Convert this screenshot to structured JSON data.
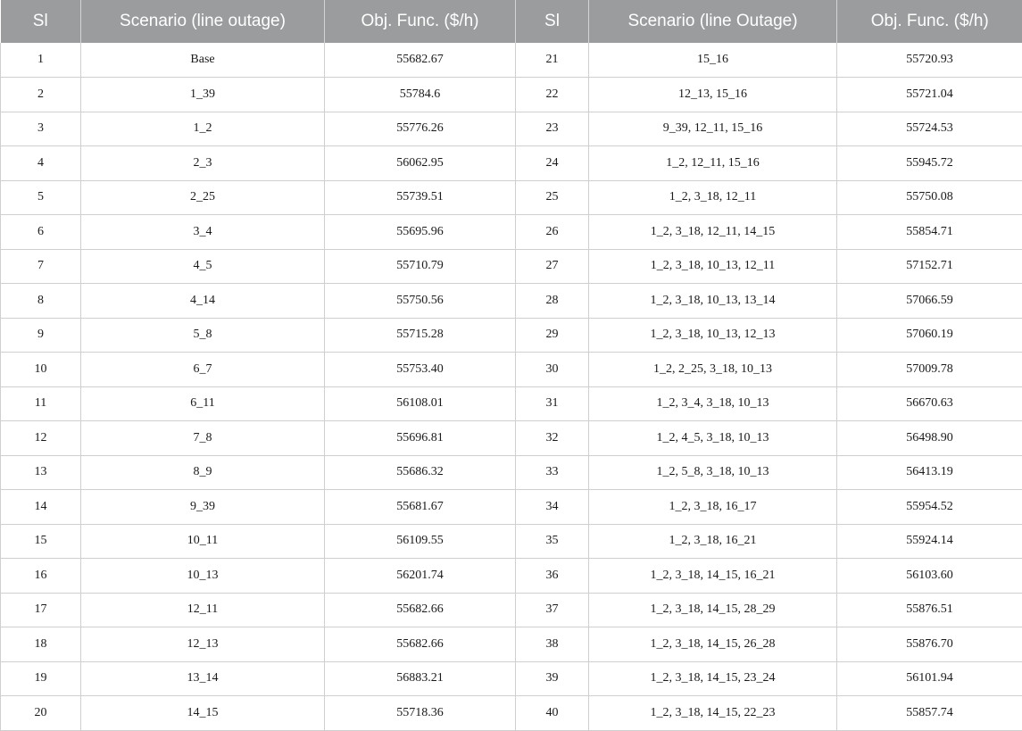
{
  "table": {
    "headers": [
      "Sl",
      "Scenario (line outage)",
      "Obj. Func. ($/h)",
      "Sl",
      "Scenario (line Outage)",
      "Obj. Func. ($/h)"
    ],
    "rows": [
      [
        "1",
        "Base",
        "55682.67",
        "21",
        "15_16",
        "55720.93"
      ],
      [
        "2",
        "1_39",
        "55784.6",
        "22",
        "12_13, 15_16",
        "55721.04"
      ],
      [
        "3",
        "1_2",
        "55776.26",
        "23",
        "9_39, 12_11, 15_16",
        "55724.53"
      ],
      [
        "4",
        "2_3",
        "56062.95",
        "24",
        "1_2, 12_11, 15_16",
        "55945.72"
      ],
      [
        "5",
        "2_25",
        "55739.51",
        "25",
        "1_2, 3_18, 12_11",
        "55750.08"
      ],
      [
        "6",
        "3_4",
        "55695.96",
        "26",
        "1_2, 3_18, 12_11, 14_15",
        "55854.71"
      ],
      [
        "7",
        "4_5",
        "55710.79",
        "27",
        "1_2, 3_18, 10_13, 12_11",
        "57152.71"
      ],
      [
        "8",
        "4_14",
        "55750.56",
        "28",
        "1_2, 3_18, 10_13, 13_14",
        "57066.59"
      ],
      [
        "9",
        "5_8",
        "55715.28",
        "29",
        "1_2, 3_18, 10_13, 12_13",
        "57060.19"
      ],
      [
        "10",
        "6_7",
        "55753.40",
        "30",
        "1_2, 2_25, 3_18, 10_13",
        "57009.78"
      ],
      [
        "11",
        "6_11",
        "56108.01",
        "31",
        "1_2, 3_4, 3_18, 10_13",
        "56670.63"
      ],
      [
        "12",
        "7_8",
        "55696.81",
        "32",
        "1_2, 4_5, 3_18, 10_13",
        "56498.90"
      ],
      [
        "13",
        "8_9",
        "55686.32",
        "33",
        "1_2, 5_8, 3_18, 10_13",
        "56413.19"
      ],
      [
        "14",
        "9_39",
        "55681.67",
        "34",
        "1_2, 3_18, 16_17",
        "55954.52"
      ],
      [
        "15",
        "10_11",
        "56109.55",
        "35",
        "1_2, 3_18, 16_21",
        "55924.14"
      ],
      [
        "16",
        "10_13",
        "56201.74",
        "36",
        "1_2, 3_18, 14_15, 16_21",
        "56103.60"
      ],
      [
        "17",
        "12_11",
        "55682.66",
        "37",
        "1_2, 3_18, 14_15, 28_29",
        "55876.51"
      ],
      [
        "18",
        "12_13",
        "55682.66",
        "38",
        "1_2, 3_18, 14_15, 26_28",
        "55876.70"
      ],
      [
        "19",
        "13_14",
        "56883.21",
        "39",
        "1_2, 3_18, 14_15, 23_24",
        "56101.94"
      ],
      [
        "20",
        "14_15",
        "55718.36",
        "40",
        "1_2, 3_18, 14_15, 22_23",
        "55857.74"
      ]
    ]
  },
  "colors": {
    "header_bg": "#9a9c9e",
    "header_text": "#ffffff",
    "grid_line": "#cfcfcf",
    "body_text": "#1a1a1a"
  }
}
